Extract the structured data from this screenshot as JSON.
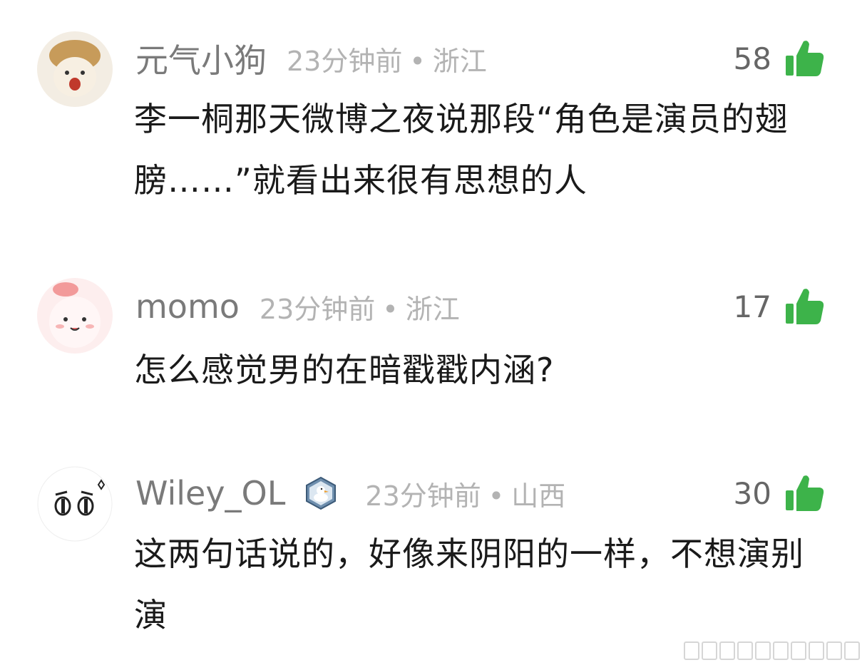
{
  "comments": [
    {
      "username": "元气小狗",
      "time": "23分钟前",
      "separator": "•",
      "location": "浙江",
      "likes": "58",
      "text": "李一桐那天微博之夜说那段“角色是演员的翅膀……”就看出来很有思想的人",
      "avatar": "shiba-dog-avatar"
    },
    {
      "username": "momo",
      "time": "23分钟前",
      "separator": "•",
      "location": "浙江",
      "likes": "17",
      "text": "怎么感觉男的在暗戳戳内涵?",
      "avatar": "pink-cartoon-avatar"
    },
    {
      "username": "Wiley_OL",
      "time": "23分钟前",
      "separator": "•",
      "location": "山西",
      "likes": "30",
      "text": "这两句话说的，好像来阴阳的一样，不想演别演",
      "avatar": "cartoon-face-avatar",
      "badge": "duck-badge-icon"
    }
  ],
  "colors": {
    "like_icon": "#3db34a",
    "username": "#7a7a7a",
    "meta": "#b3b3b3",
    "text": "#1a1a1a"
  }
}
